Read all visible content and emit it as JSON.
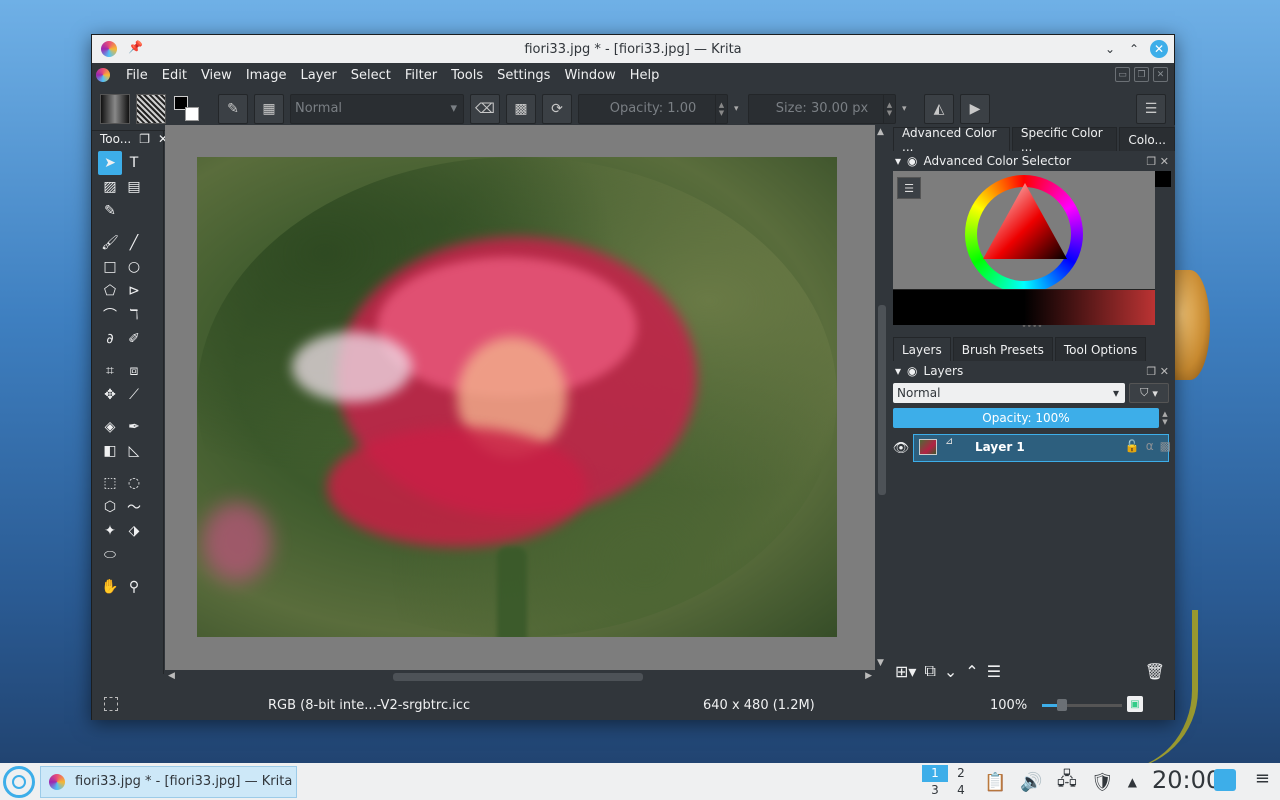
{
  "window": {
    "title": "fiori33.jpg * - [fiori33.jpg] — Krita"
  },
  "menu": [
    "File",
    "Edit",
    "View",
    "Image",
    "Layer",
    "Select",
    "Filter",
    "Tools",
    "Settings",
    "Window",
    "Help"
  ],
  "toolbar": {
    "blend_mode": "Normal",
    "opacity_label": "Opacity:  1.00",
    "size_label": "Size:  30.00 px"
  },
  "toolbox": {
    "title": "Too..."
  },
  "docker": {
    "tabs": [
      "Advanced Color ...",
      "Specific Color ...",
      "Colo..."
    ],
    "color_selector_title": "Advanced Color Selector",
    "layer_tabs": [
      "Layers",
      "Brush Presets",
      "Tool Options"
    ],
    "layers_title": "Layers",
    "layers_blend": "Normal",
    "layers_opacity": "Opacity:  100%",
    "layer_name": "Layer 1"
  },
  "statusbar": {
    "profile": "RGB (8-bit inte...-V2-srgbtrc.icc",
    "dimensions": "640 x 480 (1.2M)",
    "zoom": "100%",
    "zoom_level": 0.25
  },
  "taskbar": {
    "task_label": "fiori33.jpg * - [fiori33.jpg] — Krita",
    "pager": [
      "1",
      "2",
      "3",
      "4"
    ],
    "clock": "20:00"
  },
  "colors": {
    "accent": "#3daee9",
    "window_bg": "#31363b",
    "canvas_bg": "#7d7d7d"
  }
}
